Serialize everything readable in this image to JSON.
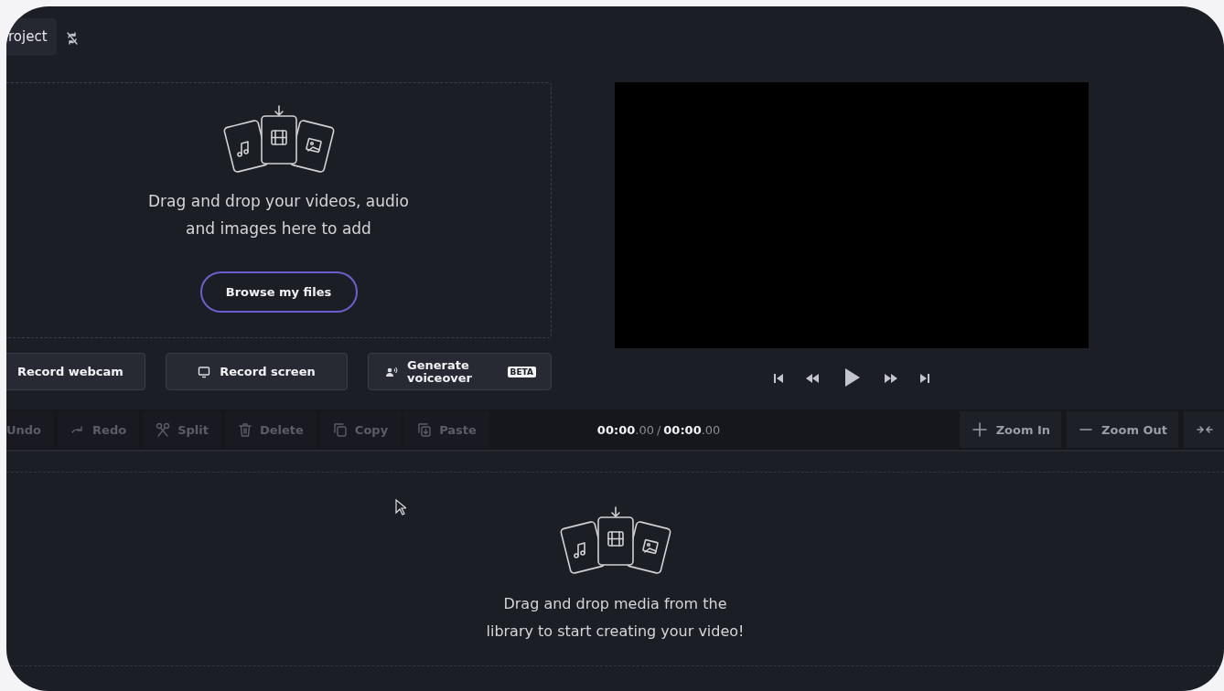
{
  "project_tab": {
    "label": "roject"
  },
  "media_dropzone": {
    "message": "Drag and drop your videos, audio and images here to add",
    "button": "Browse my files"
  },
  "record_buttons": [
    {
      "kind": "webcam",
      "label": "Record webcam"
    },
    {
      "kind": "screen",
      "label": "Record screen"
    },
    {
      "kind": "voiceover",
      "label": "Generate voiceover",
      "badge": "BETA"
    }
  ],
  "player_controls": [
    {
      "kind": "start"
    },
    {
      "kind": "rewind"
    },
    {
      "kind": "play"
    },
    {
      "kind": "forward"
    },
    {
      "kind": "end"
    }
  ],
  "edit_toolbar": [
    {
      "kind": "undo",
      "label": "Undo",
      "disabled": true
    },
    {
      "kind": "redo",
      "label": "Redo",
      "disabled": true
    },
    {
      "kind": "split",
      "label": "Split",
      "disabled": true
    },
    {
      "kind": "delete",
      "label": "Delete",
      "disabled": true
    },
    {
      "kind": "copy",
      "label": "Copy",
      "disabled": true
    },
    {
      "kind": "paste",
      "label": "Paste",
      "disabled": true
    }
  ],
  "timecode": {
    "current": {
      "whole": "00:00",
      "fraction": ".00"
    },
    "separator": "/",
    "total": {
      "whole": "00:00",
      "fraction": ".00"
    }
  },
  "zoom_toolbar": [
    {
      "kind": "zoom_in",
      "label": "Zoom In"
    },
    {
      "kind": "zoom_out",
      "label": "Zoom Out"
    },
    {
      "kind": "fit"
    }
  ],
  "timeline": {
    "message": "Drag and drop media from the library to start creating your video!"
  }
}
